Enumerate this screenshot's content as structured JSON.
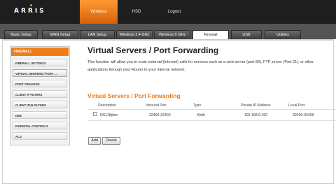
{
  "header": {
    "logo": "ARRIS",
    "nav": [
      "Wireless",
      "HSD",
      "Logout"
    ]
  },
  "tabs": [
    "Basic Setup",
    "WAN Setup",
    "LAN Setup",
    "Wireless 2.4 GHz",
    "Wireless 5 GHz",
    "Firewall",
    "USB",
    "Utilities"
  ],
  "sidebar": {
    "header": "FIREWALL",
    "items": [
      "FIREWALL SETTINGS",
      "VIRTUAL SERVERS / PORT ...",
      "PORT TRIGGERS",
      "CLIENT IP FILTERS",
      "CLIENT IPV6 FILTERS",
      "DMZ",
      "PARENTAL CONTROLS",
      "ALG"
    ]
  },
  "main": {
    "title": "Virtual Servers / Port Forwarding",
    "description": "This function will allow you to route external (Internet) calls for services such as a web server (port 80), FTP server (Port 21), or other applications through your Router to your internal network.",
    "section_title": "Virtual Servers / Port Forwarding",
    "table": {
      "columns": [
        "Description",
        "Inbound Port",
        "Type",
        "Private IP Address",
        "Local Port"
      ],
      "rows": [
        {
          "description": "DS118plex",
          "inbound_port": "32400-32400",
          "type": "Both",
          "private_ip": "192.168.0.100",
          "local_port": "32400-32400"
        }
      ]
    },
    "buttons": {
      "add": "Add",
      "delete": "Delete"
    }
  },
  "colors": {
    "accent": "#f07d1c",
    "header_bg": "#1e1e1e",
    "tab_band": "#555555"
  }
}
